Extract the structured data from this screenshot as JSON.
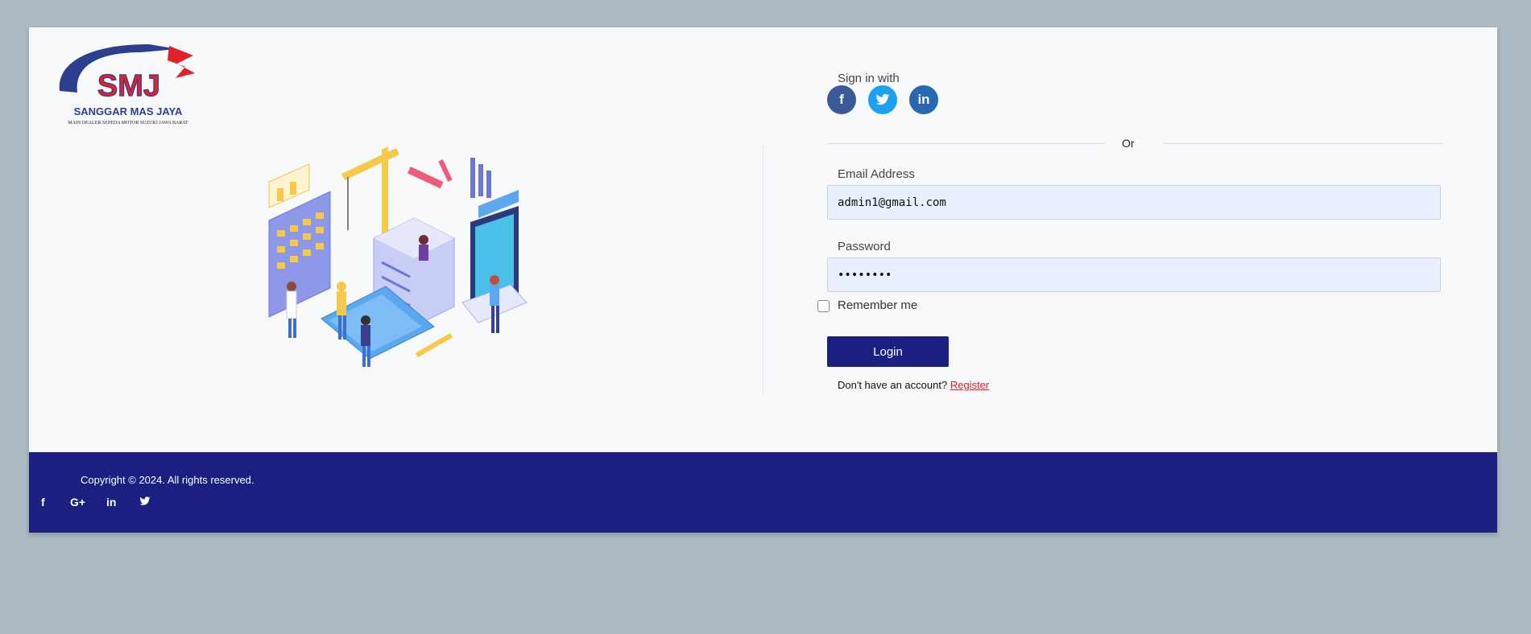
{
  "logo": {
    "brand": "SMJ",
    "name": "SANGGAR MAS JAYA",
    "tagline": "MAIN DEALER SEPEDA MOTOR SUZUKI JAWA BARAT"
  },
  "signin": {
    "label": "Sign in with",
    "icons": [
      "facebook-icon",
      "twitter-icon",
      "linkedin-icon"
    ]
  },
  "divider": {
    "text": "Or"
  },
  "form": {
    "email_label": "Email Address",
    "email_value": "admin1@gmail.com",
    "password_label": "Password",
    "password_value": "••••••••",
    "remember_label": "Remember me",
    "login_label": "Login",
    "no_account_text": "Don't have an account?",
    "register_link": "Register"
  },
  "footer": {
    "copyright": "Copyright © 2024. All rights reserved.",
    "icons": [
      "facebook-icon",
      "google-plus-icon",
      "linkedin-icon",
      "twitter-icon"
    ]
  },
  "colors": {
    "primary": "#1b1f80",
    "background": "#adbac3",
    "card": "#f7f9fb",
    "link": "#e51a2a",
    "facebook": "#3b5998",
    "twitter": "#1da1f2",
    "linkedin": "#2867b2"
  }
}
